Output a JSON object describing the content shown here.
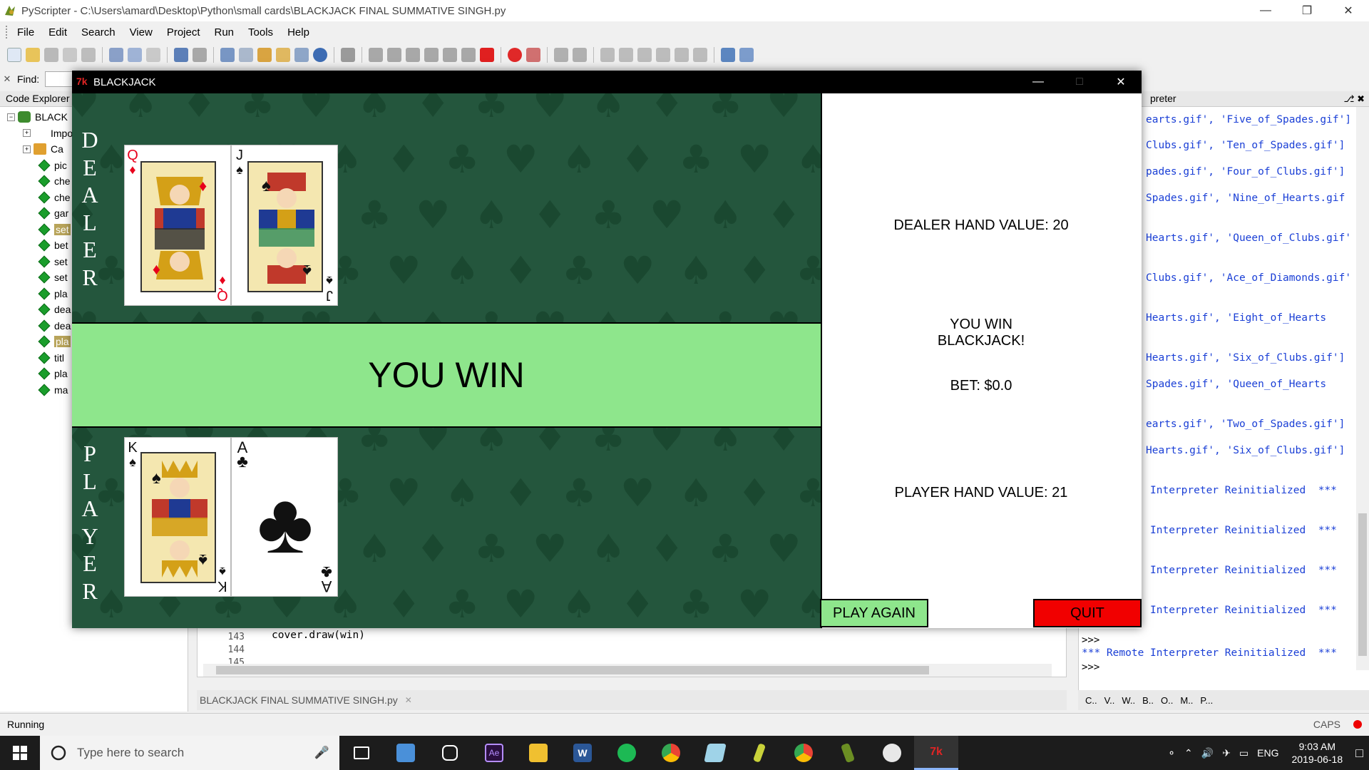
{
  "ide": {
    "title": "PyScripter - C:\\Users\\amard\\Desktop\\Python\\small cards\\BLACKJACK FINAL SUMMATIVE SINGH.py",
    "menu": [
      "File",
      "Edit",
      "Search",
      "View",
      "Project",
      "Run",
      "Tools",
      "Help"
    ],
    "find_label": "Find:",
    "code_explorer_title": "Code Explorer",
    "tree": [
      {
        "label": "BLACK",
        "kind": "module"
      },
      {
        "label": "Impor",
        "kind": "imports"
      },
      {
        "label": "Ca",
        "kind": "class"
      },
      {
        "label": "pic",
        "kind": "func"
      },
      {
        "label": "che",
        "kind": "func"
      },
      {
        "label": "che",
        "kind": "func"
      },
      {
        "label": "gar",
        "kind": "func"
      },
      {
        "label": "set",
        "kind": "func",
        "highlight": true
      },
      {
        "label": "bet",
        "kind": "func"
      },
      {
        "label": "set",
        "kind": "func"
      },
      {
        "label": "set",
        "kind": "func"
      },
      {
        "label": "pla",
        "kind": "func"
      },
      {
        "label": "dea",
        "kind": "func"
      },
      {
        "label": "dea",
        "kind": "func"
      },
      {
        "label": "pla",
        "kind": "func",
        "highlight": true
      },
      {
        "label": "titl",
        "kind": "func"
      },
      {
        "label": "pla",
        "kind": "func"
      },
      {
        "label": "ma",
        "kind": "func"
      }
    ],
    "interpreter_title": "preter",
    "interpreter_lines": [
      "earts.gif', 'Five_of_Spades.gif']",
      "Clubs.gif', 'Ten_of_Spades.gif']",
      "pades.gif', 'Four_of_Clubs.gif']",
      "Spades.gif', 'Nine_of_Hearts.gif",
      "Hearts.gif', 'Queen_of_Clubs.gif'",
      "Clubs.gif', 'Ace_of_Diamonds.gif'",
      "Hearts.gif', 'Eight_of_Hearts",
      "Hearts.gif', 'Six_of_Clubs.gif']",
      "Spades.gif', 'Queen_of_Hearts",
      "earts.gif', 'Two_of_Spades.gif']",
      "Hearts.gif', 'Six_of_Clubs.gif']",
      "Interpreter Reinitialized  ***",
      "Interpreter Reinitialized  ***",
      "Interpreter Reinitialized  ***",
      "Interpreter Reinitialized  ***"
    ],
    "interpreter_tail": {
      "prompt1": ">>>",
      "remote": "*** Remote Interpreter Reinitialized  ***",
      "prompt2": ">>>"
    },
    "editor": {
      "line_numbers": [
        "143",
        "144",
        "145"
      ],
      "code_line": "cover.draw(win)"
    },
    "editor_tab": "BLACKJACK FINAL SUMMATIVE SINGH.py",
    "bottom_tools": [
      "C..",
      "V..",
      "W..",
      "B..",
      "O..",
      "M..",
      "P..."
    ],
    "status": "Running",
    "caps": "CAPS"
  },
  "taskbar": {
    "search_placeholder": "Type here to search",
    "time": "9:03 AM",
    "date": "2019-06-18",
    "lang": "ENG",
    "apps": [
      "task-view",
      "explorer-alt",
      "instagram",
      "after-effects",
      "file-explorer",
      "word",
      "spotify",
      "chrome",
      "notepad",
      "python",
      "chrome",
      "pyscripter",
      "paint",
      "tk"
    ]
  },
  "blackjack": {
    "window_title": "BLACKJACK",
    "dealer_label": "DEALER",
    "player_label": "PLAYER",
    "banner": "YOU WIN",
    "dealer_hand_value": "DEALER HAND VALUE: 20",
    "result_line1": "YOU WIN",
    "result_line2": "BLACKJACK!",
    "bet": "BET: $0.0",
    "player_hand_value": "PLAYER HAND VALUE: 21",
    "play_again": "PLAY AGAIN",
    "quit": "QUIT",
    "dealer_cards": [
      {
        "rank": "Q",
        "suit": "♦",
        "color": "red",
        "name": "Queen of Diamonds"
      },
      {
        "rank": "J",
        "suit": "♠",
        "color": "black",
        "name": "Jack of Spades"
      }
    ],
    "player_cards": [
      {
        "rank": "K",
        "suit": "♠",
        "color": "black",
        "name": "King of Spades"
      },
      {
        "rank": "A",
        "suit": "♣",
        "color": "black",
        "name": "Ace of Clubs"
      }
    ]
  },
  "colors": {
    "felt": "#24563d",
    "banner": "#8ee68c",
    "quit": "#f10000"
  }
}
